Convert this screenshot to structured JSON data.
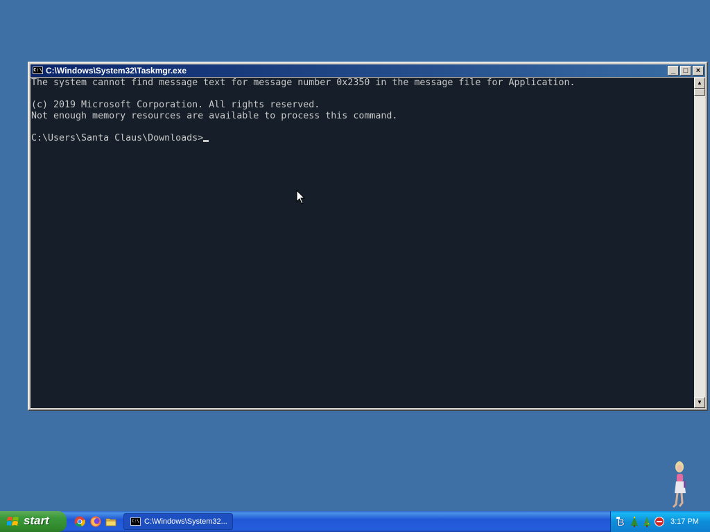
{
  "window": {
    "title": "C:\\Windows\\System32\\Taskmgr.exe",
    "icon_label": "C:\\",
    "buttons": {
      "minimize": "_",
      "maximize": "□",
      "close": "×"
    }
  },
  "console": {
    "lines": [
      "The system cannot find message text for message number 0x2350 in the message file for Application.",
      "",
      "(c) 2019 Microsoft Corporation. All rights reserved.",
      "Not enough memory resources are available to process this command.",
      ""
    ],
    "prompt": "C:\\Users\\Santa Claus\\Downloads>"
  },
  "taskbar": {
    "start_label": "start",
    "quick_launch": [
      "chrome-icon",
      "firefox-icon",
      "folder-icon"
    ],
    "tasks": [
      {
        "label": "C:\\Windows\\System32...",
        "icon": "cmd-icon"
      }
    ],
    "tray_icons": [
      "tb-icon",
      "tree-icon",
      "tree-icon",
      "stop-icon"
    ],
    "clock": "3:17 PM"
  },
  "colors": {
    "desktop": "#3e6fa5",
    "console_bg": "#161f29",
    "console_text": "#c8c8c8",
    "titlebar_start": "#0a246a",
    "titlebar_end": "#3a6ea5",
    "taskbar": "#245edb",
    "start_button": "#3c9a3c",
    "tray": "#0f8fdb"
  }
}
